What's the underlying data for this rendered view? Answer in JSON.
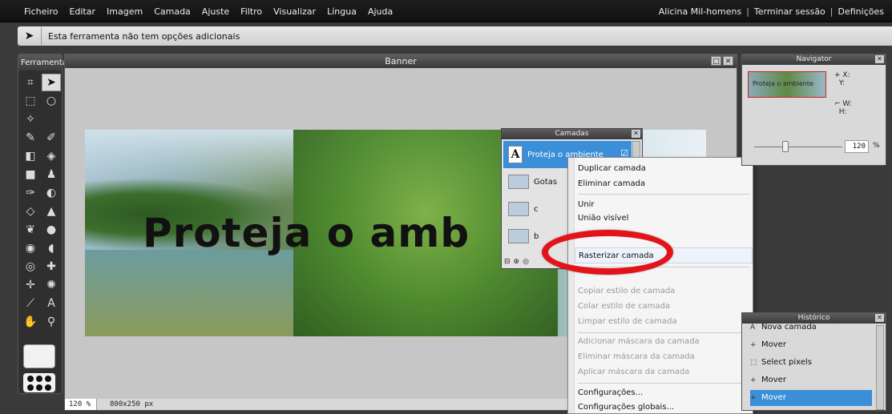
{
  "menubar": {
    "items": [
      "Ficheiro",
      "Editar",
      "Imagem",
      "Camada",
      "Ajuste",
      "Filtro",
      "Visualizar",
      "Língua",
      "Ajuda"
    ],
    "user": "Alicina Mil-homens",
    "logout": "Terminar sessão",
    "settings": "Definições",
    "separator": "|"
  },
  "options_bar": {
    "tool_icon": "move-tool-icon",
    "text": "Esta ferramenta não tem opções adicionais"
  },
  "toolbox": {
    "title": "Ferramentas",
    "tools": [
      {
        "icon": "crop-icon",
        "glyph": "⌗"
      },
      {
        "icon": "move-icon",
        "glyph": "➤"
      },
      {
        "icon": "marquee-icon",
        "glyph": "⬚"
      },
      {
        "icon": "lasso-icon",
        "glyph": "○"
      },
      {
        "icon": "magic-wand-icon",
        "glyph": "✧"
      },
      {
        "icon": "blank",
        "glyph": ""
      },
      {
        "icon": "pencil-icon",
        "glyph": "✎"
      },
      {
        "icon": "brush-icon",
        "glyph": "✐"
      },
      {
        "icon": "eraser-icon",
        "glyph": "◧"
      },
      {
        "icon": "bucket-icon",
        "glyph": "◈"
      },
      {
        "icon": "gradient-icon",
        "glyph": "■"
      },
      {
        "icon": "stamp-icon",
        "glyph": "♟"
      },
      {
        "icon": "color-replace-icon",
        "glyph": "✑"
      },
      {
        "icon": "drawing-icon",
        "glyph": "◐"
      },
      {
        "icon": "blur-icon",
        "glyph": "◇"
      },
      {
        "icon": "sharpen-icon",
        "glyph": "▲"
      },
      {
        "icon": "smudge-icon",
        "glyph": "❦"
      },
      {
        "icon": "sponge-icon",
        "glyph": "●"
      },
      {
        "icon": "dodge-icon",
        "glyph": "◉"
      },
      {
        "icon": "burn-icon",
        "glyph": "◖"
      },
      {
        "icon": "red-eye-icon",
        "glyph": "◎"
      },
      {
        "icon": "spot-heal-icon",
        "glyph": "✚"
      },
      {
        "icon": "bloat-icon",
        "glyph": "✛"
      },
      {
        "icon": "pinch-icon",
        "glyph": "✺"
      },
      {
        "icon": "color-picker-icon",
        "glyph": "⟋"
      },
      {
        "icon": "type-icon",
        "glyph": "A"
      },
      {
        "icon": "hand-icon",
        "glyph": "✋"
      },
      {
        "icon": "zoom-icon",
        "glyph": "⚲"
      }
    ]
  },
  "document": {
    "title": "Banner",
    "zoom": "120 %",
    "size": "800x250 px",
    "banner_text": "Proteja o amb"
  },
  "layers_panel": {
    "title": "Camadas",
    "layers": [
      {
        "name": "Proteja o ambiente",
        "thumb": "A",
        "active": true
      },
      {
        "name": "Gotas",
        "thumb": "",
        "active": false
      },
      {
        "name": "c",
        "thumb": "",
        "active": false
      },
      {
        "name": "b",
        "thumb": "",
        "active": false
      }
    ],
    "check": "☑",
    "footer": [
      "⊟",
      "⊕",
      "◎"
    ]
  },
  "context_menu": {
    "items": [
      {
        "label": "Duplicar camada",
        "disabled": false
      },
      {
        "label": "Eliminar camada",
        "disabled": false
      },
      {
        "label": "Unir",
        "disabled": false
      },
      {
        "label": "União visível",
        "disabled": false
      },
      {
        "label": "Rasterizar camada",
        "disabled": false,
        "highlight": true
      },
      {
        "label": "Copiar estilo de camada",
        "disabled": true
      },
      {
        "label": "Colar estilo de camada",
        "disabled": true
      },
      {
        "label": "Limpar estilo de camada",
        "disabled": true
      },
      {
        "label": "Adicionar máscara da camada",
        "disabled": true
      },
      {
        "label": "Eliminar máscara da camada",
        "disabled": true
      },
      {
        "label": "Aplicar máscara da camada",
        "disabled": true
      },
      {
        "label": "Configurações...",
        "disabled": false
      },
      {
        "label": "Configurações globais...",
        "disabled": false
      }
    ],
    "annotation_color": "#e3131a"
  },
  "navigator": {
    "title": "Navigator",
    "thumb_text": "Proteja o ambiente",
    "x_label": "X:",
    "y_label": "Y:",
    "w_label": "W:",
    "h_label": "H:",
    "zoom_value": "120",
    "zoom_unit": "%"
  },
  "history": {
    "title": "Histórico",
    "items": [
      {
        "label": "Nova camada",
        "icon": "A"
      },
      {
        "label": "Mover",
        "icon": "+"
      },
      {
        "label": "Select pixels",
        "icon": "⬚"
      },
      {
        "label": "Mover",
        "icon": "+"
      },
      {
        "label": "Mover",
        "icon": "+",
        "active": true
      }
    ]
  }
}
